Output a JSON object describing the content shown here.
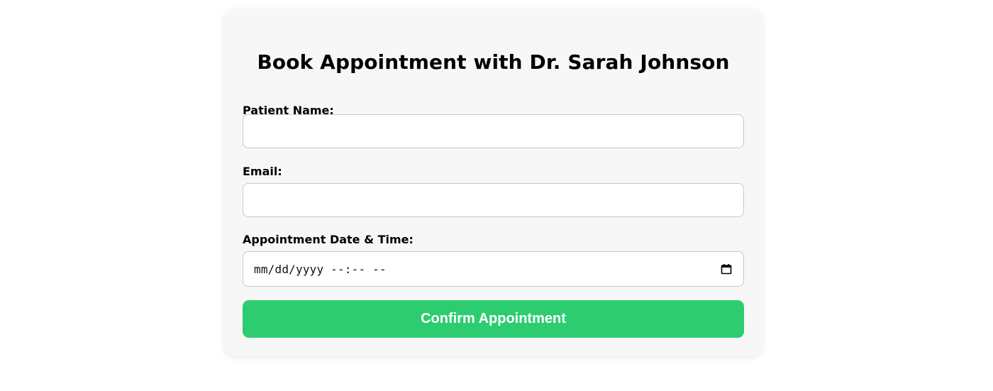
{
  "form": {
    "title": "Book Appointment with Dr. Sarah Johnson",
    "patient_name": {
      "label": "Patient Name:",
      "value": "",
      "placeholder": ""
    },
    "email": {
      "label": "Email:",
      "value": "",
      "placeholder": ""
    },
    "datetime": {
      "label": "Appointment Date & Time:",
      "placeholder": "mm/dd/yyyy --:-- --",
      "icon": "calendar-icon"
    },
    "submit_label": "Confirm Appointment"
  },
  "colors": {
    "card_background": "#f7f7f7",
    "button_background": "#2ecc71",
    "button_text": "#ffffff",
    "input_border": "#c9c9c9"
  }
}
